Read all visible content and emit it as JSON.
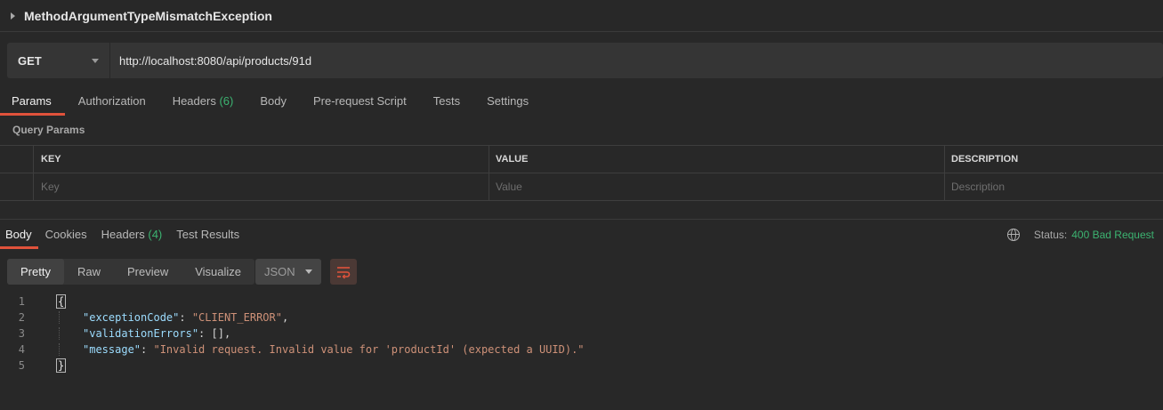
{
  "request": {
    "name": "MethodArgumentTypeMismatchException",
    "method": "GET",
    "url": "http://localhost:8080/api/products/91d"
  },
  "request_tabs": [
    {
      "label": "Params"
    },
    {
      "label": "Authorization"
    },
    {
      "label": "Headers",
      "count": "(6)"
    },
    {
      "label": "Body"
    },
    {
      "label": "Pre-request Script"
    },
    {
      "label": "Tests"
    },
    {
      "label": "Settings"
    }
  ],
  "query_params": {
    "title": "Query Params",
    "columns": [
      "KEY",
      "VALUE",
      "DESCRIPTION"
    ],
    "placeholders": {
      "key": "Key",
      "value": "Value",
      "description": "Description"
    }
  },
  "response_tabs": [
    {
      "label": "Body"
    },
    {
      "label": "Cookies"
    },
    {
      "label": "Headers",
      "count": "(4)"
    },
    {
      "label": "Test Results"
    }
  ],
  "status": {
    "label": "Status:",
    "value": "400 Bad Request"
  },
  "view_modes": [
    "Pretty",
    "Raw",
    "Preview",
    "Visualize"
  ],
  "format": "JSON",
  "body_lines": {
    "n1": "1",
    "n2": "2",
    "n3": "3",
    "n4": "4",
    "n5": "5",
    "open": "{",
    "k1": "\"exceptionCode\"",
    "v1": "\"CLIENT_ERROR\"",
    "k2": "\"validationErrors\"",
    "v2": "[]",
    "k3": "\"message\"",
    "v3": "\"Invalid request. Invalid value for 'productId' (expected a UUID).\"",
    "close": "}"
  },
  "colors": {
    "accent": "#e0523b",
    "success": "#3cb371",
    "background": "#282828"
  }
}
